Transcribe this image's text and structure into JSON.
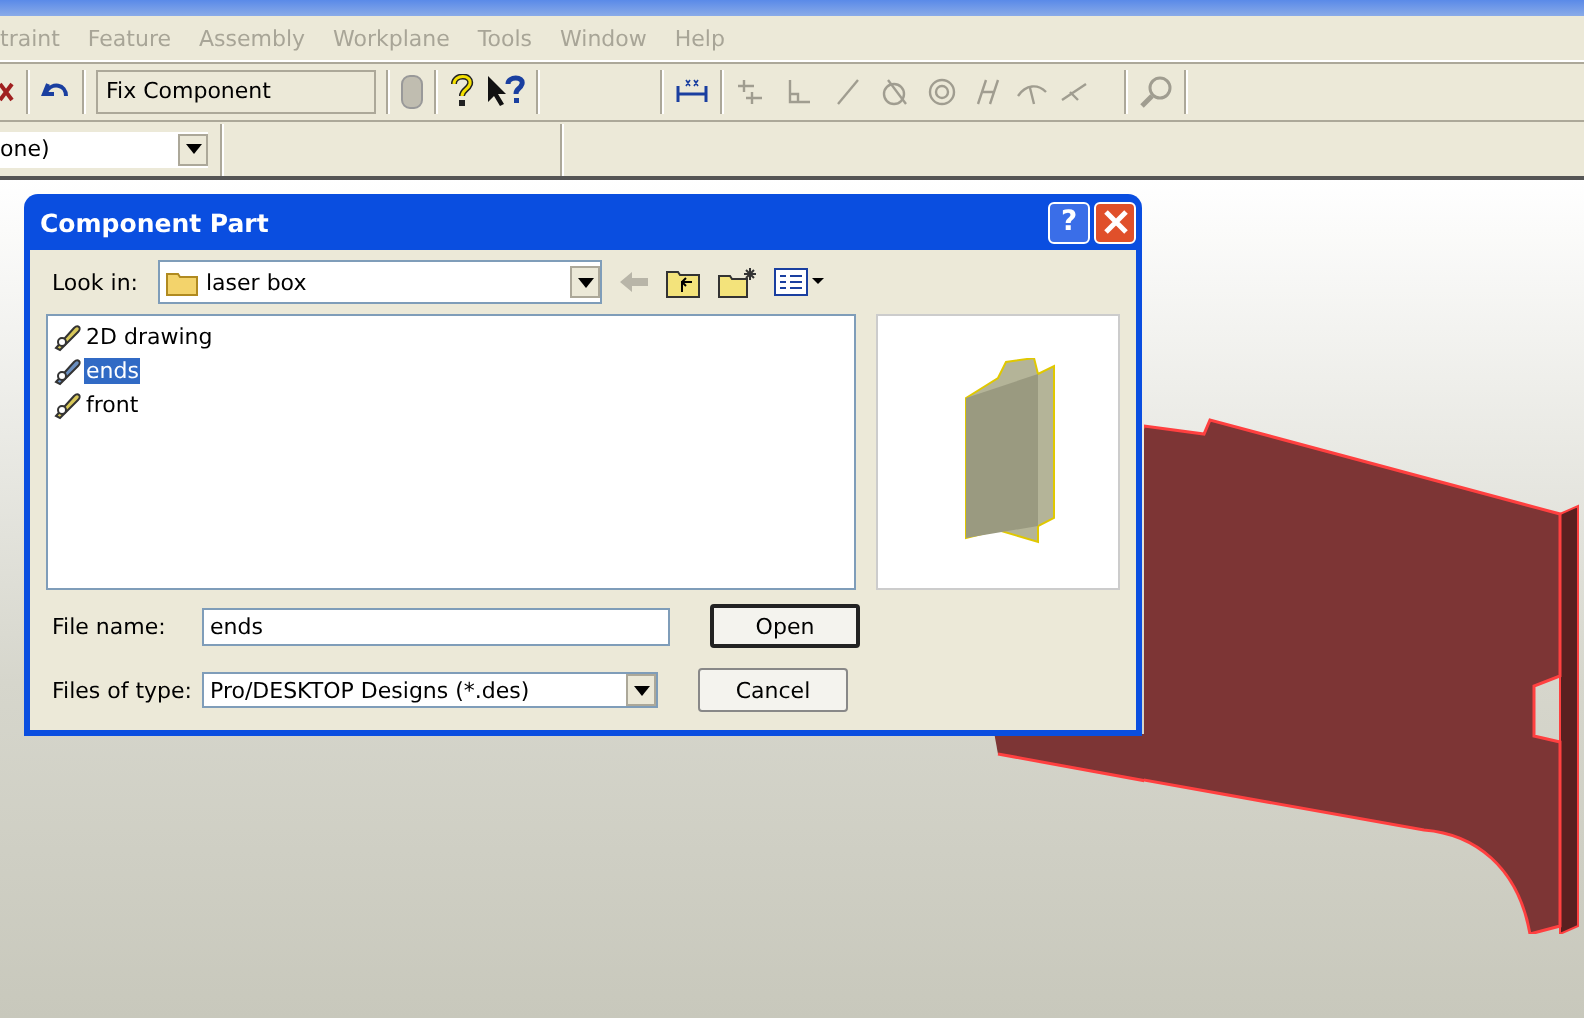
{
  "menu": [
    {
      "label": "traint",
      "disabled": true
    },
    {
      "label": "Feature",
      "disabled": true
    },
    {
      "label": "Assembly",
      "disabled": true
    },
    {
      "label": "Workplane",
      "disabled": true
    },
    {
      "label": "Tools",
      "disabled": true
    },
    {
      "label": "Window",
      "disabled": true
    },
    {
      "label": "Help",
      "disabled": true
    }
  ],
  "toolbar": {
    "command_field": "Fix Component"
  },
  "selector": {
    "value": "one)"
  },
  "dialog": {
    "title": "Component Part",
    "look_in_label": "Look in:",
    "look_in_value": "laser box",
    "files": [
      {
        "name": "2D drawing",
        "selected": false
      },
      {
        "name": "ends",
        "selected": true
      },
      {
        "name": "front",
        "selected": false
      }
    ],
    "file_name_label": "File name:",
    "file_name_value": "ends",
    "file_type_label": "Files of type:",
    "file_type_value": "Pro/DESKTOP Designs (*.des)",
    "buttons": [
      "Open",
      "Cancel"
    ],
    "help_button": "?"
  }
}
